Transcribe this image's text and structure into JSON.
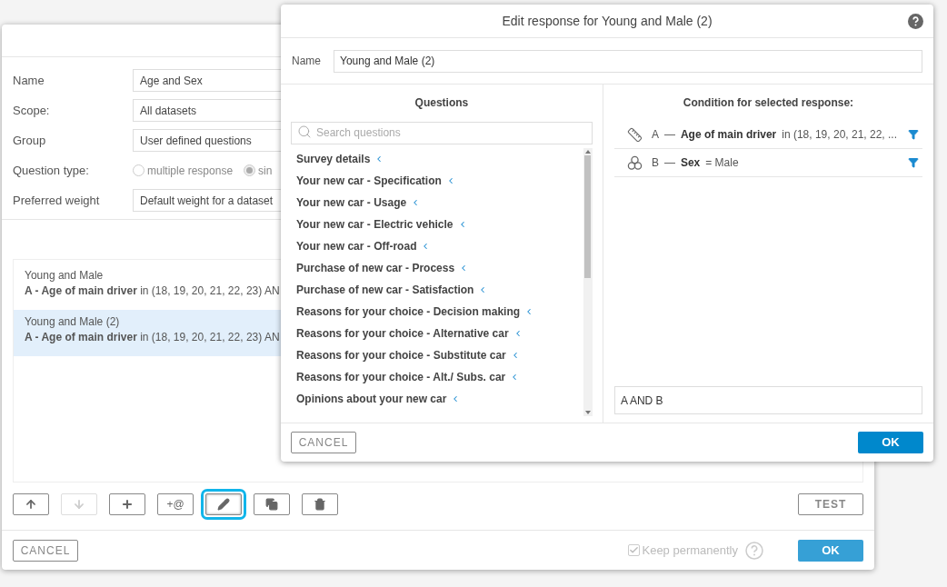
{
  "main_dialog": {
    "form": [
      {
        "kind": "field",
        "label": "Name",
        "value": "Age and Sex"
      },
      {
        "kind": "field",
        "label": "Scope:",
        "value": "All datasets"
      },
      {
        "kind": "field",
        "label": "Group",
        "value": "User defined questions"
      },
      {
        "kind": "radio",
        "label": "Question type:",
        "options": [
          {
            "label": "multiple response",
            "selected": false
          },
          {
            "label": "sin",
            "selected": true
          }
        ]
      },
      {
        "kind": "field",
        "label": "Preferred weight",
        "value": "Default weight for a dataset"
      }
    ],
    "responses": [
      {
        "name": "Young and Male",
        "condition": "**A - Age of main driver** in (18, 19, 20, 21, 22, 23) AN",
        "selected": false
      },
      {
        "name": "Young and Male (2)",
        "condition": "**A - Age of main driver** in (18, 19, 20, 21, 22, 23) AN",
        "selected": true
      }
    ],
    "toolbar": [
      {
        "kind": "move-up",
        "disabled": false,
        "focused": false
      },
      {
        "kind": "move-down",
        "disabled": true,
        "focused": false
      },
      {
        "kind": "add",
        "disabled": false,
        "focused": false
      },
      {
        "kind": "add-reference",
        "label": "+@",
        "disabled": false,
        "focused": false
      },
      {
        "kind": "edit",
        "disabled": false,
        "focused": true
      },
      {
        "kind": "copy",
        "disabled": false,
        "focused": false
      },
      {
        "kind": "delete",
        "disabled": false,
        "focused": false
      }
    ],
    "test_button": "TEST",
    "cancel_button": "CANCEL",
    "keep_permanently": {
      "label": "Keep permanently",
      "checked": true,
      "disabled": true
    },
    "ok_button": "OK"
  },
  "edit_dialog": {
    "title": "Edit response for Young and Male (2)",
    "name_label": "Name",
    "name_value": "Young and Male (2)",
    "questions_heading": "Questions",
    "search": {
      "placeholder": "Search questions"
    },
    "questions": [
      "Survey details",
      "Your new car - Specification",
      "Your new car - Usage",
      "Your new car - Electric vehicle",
      "Your new car - Off-road",
      "Purchase of new car - Process",
      "Purchase of new car - Satisfaction",
      "Reasons for your choice - Decision making",
      "Reasons for your choice - Alternative car",
      "Reasons for your choice - Substitute car",
      "Reasons for your choice - Alt./ Subs. car",
      "Opinions about your new car"
    ],
    "condition_heading": "Condition for selected response:",
    "conditions": [
      {
        "kind": "numeric",
        "letter": "A",
        "dash": "—",
        "question": "Age of main driver",
        "condition": "in (18, 19, 20, 21, 22, ..."
      },
      {
        "kind": "categorical",
        "letter": "B",
        "dash": "—",
        "question": "Sex",
        "condition": "= Male"
      }
    ],
    "formula": "A AND B",
    "cancel_button": "CANCEL",
    "ok_button": "OK"
  }
}
